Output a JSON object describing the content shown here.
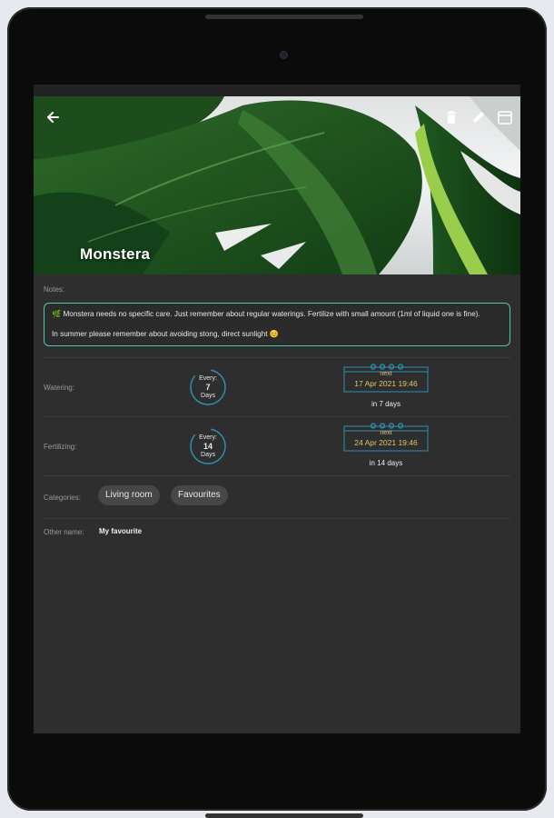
{
  "plant": {
    "name": "Monstera",
    "notes_label": "Notes:",
    "notes": [
      "🌿 Monstera needs no specific care. Just remember about regular waterings. Fertilize with small amount (1ml of liquid one is fine).",
      "In summer please remember about avoiding stong, direct sunlight 😊"
    ]
  },
  "toolbar": {
    "back_icon": "arrow-left-icon",
    "delete_icon": "trash-icon",
    "edit_icon": "pencil-icon",
    "calendar_icon": "calendar-icon"
  },
  "watering": {
    "label": "Watering:",
    "every_label": "Every:",
    "every_value": "7",
    "unit": "Days",
    "next_label": "next",
    "next_date": "17 Apr 2021 19:46",
    "in_text": "in 7 days"
  },
  "fertilizing": {
    "label": "Fertilizing:",
    "every_label": "Every:",
    "every_value": "14",
    "unit": "Days",
    "next_label": "next",
    "next_date": "24 Apr 2021 19:46",
    "in_text": "in 14 days"
  },
  "categories": {
    "label": "Categories:",
    "items": [
      "Living room",
      "Favourites"
    ]
  },
  "other_name": {
    "label": "Other name:",
    "value": "My favourite"
  },
  "colors": {
    "accent": "#4fc6b4",
    "date_text": "#e2c56a",
    "calendar_border": "#2f8fb0",
    "background": "#2e2e2e"
  }
}
